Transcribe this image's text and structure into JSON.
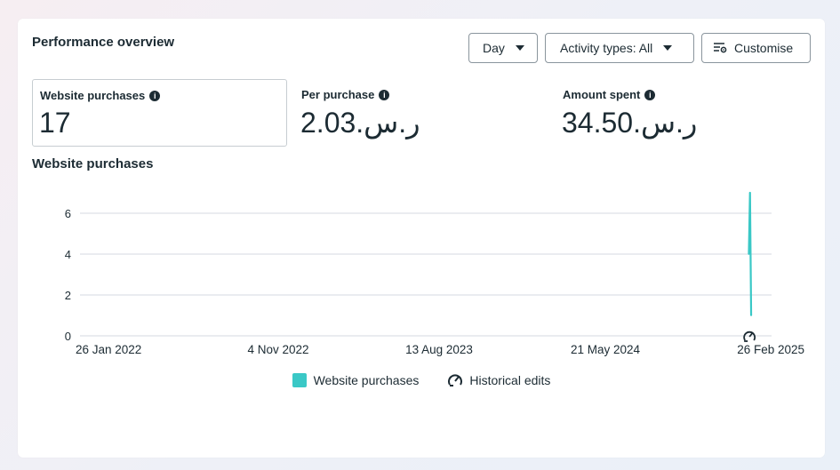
{
  "header": {
    "title": "Performance overview",
    "day_label": "Day",
    "activity_label": "Activity types: All",
    "customise_label": "Customise"
  },
  "metrics": [
    {
      "label": "Website purchases",
      "value": "17",
      "selected": true
    },
    {
      "label": "Per purchase",
      "value": "2.03.ر.س"
    },
    {
      "label": "Amount spent",
      "value": "34.50.ر.س"
    }
  ],
  "section_title": "Website purchases",
  "colors": {
    "series": "#3ac8c6",
    "grid": "#e4e6eb",
    "axis_text": "#1c2b33"
  },
  "chart_data": {
    "type": "line",
    "title": "Website purchases",
    "ylim": [
      0,
      6
    ],
    "yticks": [
      "0",
      "2",
      "4",
      "6"
    ],
    "xticks": [
      "26 Jan 2022",
      "4 Nov 2022",
      "13 Aug 2023",
      "21 May 2024",
      "26 Feb 2025"
    ],
    "xlim": [
      "26 Jan 2022",
      "26 Feb 2025"
    ],
    "series": [
      {
        "name": "Website purchases",
        "x": [
          "2025-01-20",
          "2025-01-21",
          "2025-01-22"
        ],
        "values": [
          4,
          7,
          1
        ]
      }
    ],
    "markers": [
      {
        "type": "historical-edit",
        "x": "2025-01-21"
      }
    ],
    "legend": [
      "Website purchases",
      "Historical edits"
    ],
    "legend_position": "bottom-center",
    "grid": true
  }
}
